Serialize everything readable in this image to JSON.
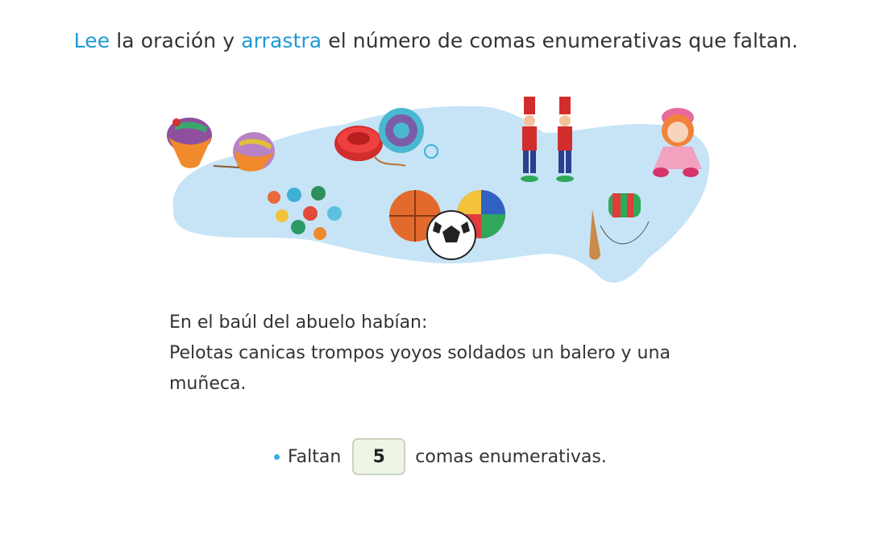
{
  "instruction": {
    "part1": "Lee",
    "part2": " la oración y ",
    "part3": "arrastra",
    "part4": " el número de comas enumerativas que faltan."
  },
  "illustration": {
    "items": [
      "trompos",
      "yoyos",
      "soldados",
      "muñeca",
      "canicas",
      "pelotas",
      "balero"
    ]
  },
  "sentence": {
    "line1": "En el baúl del abuelo habían:",
    "line2": "Pelotas canicas trompos yoyos soldados un balero y una muñeca."
  },
  "answer": {
    "prefix": "Faltan",
    "value": "5",
    "suffix": "comas enumerativas."
  },
  "colors": {
    "accent": "#1e9ad6",
    "blob": "#c6e4f6",
    "box_bg": "#eef5e6",
    "box_border": "#c9d3bf"
  }
}
